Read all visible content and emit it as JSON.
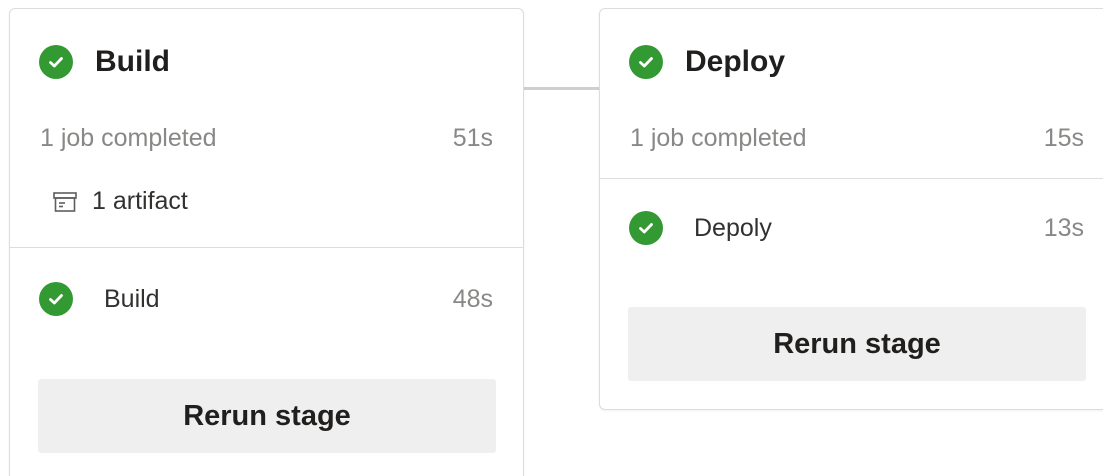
{
  "stages": [
    {
      "title": "Build",
      "status_icon": "check-circle-icon",
      "summary": "1 job completed",
      "duration": "51s",
      "artifact_icon": "artifact-box-icon",
      "artifact_label": "1 artifact",
      "job": {
        "name": "Build",
        "duration": "48s",
        "status_icon": "check-circle-icon"
      },
      "rerun_label": "Rerun stage"
    },
    {
      "title": "Deploy",
      "status_icon": "check-circle-icon",
      "summary": "1 job completed",
      "duration": "15s",
      "job": {
        "name": "Depoly",
        "duration": "13s",
        "status_icon": "check-circle-icon"
      },
      "rerun_label": "Rerun stage"
    }
  ],
  "colors": {
    "success": "#339933",
    "muted_text": "#8a8886",
    "button_bg": "#efefef",
    "border": "#dcdcdc"
  }
}
